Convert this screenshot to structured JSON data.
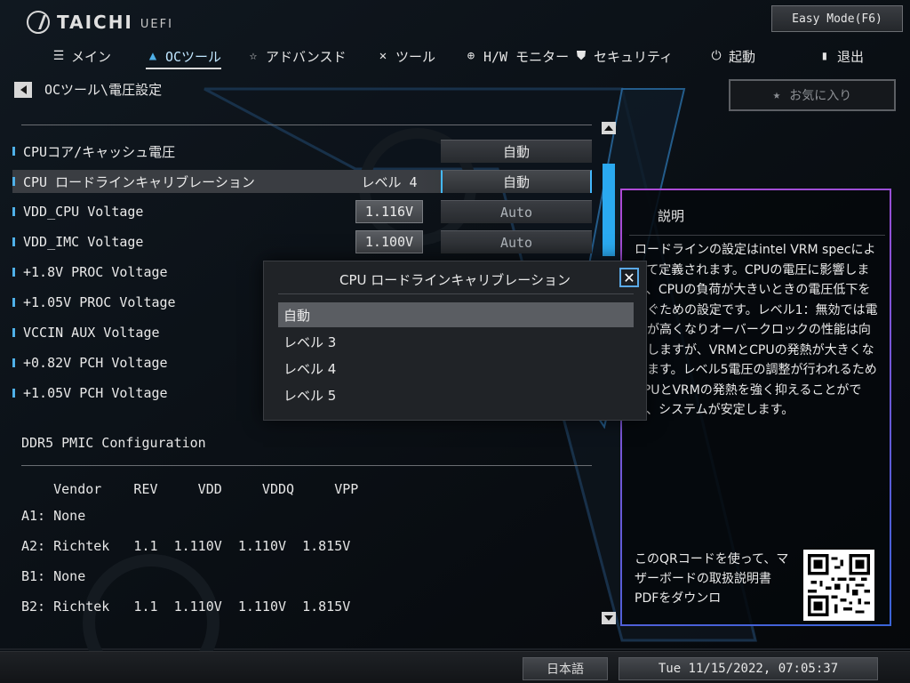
{
  "brand": {
    "name": "TAICHI",
    "sub": "UEFI"
  },
  "easy_mode": "Easy Mode(F6)",
  "nav": [
    {
      "label": "メイン",
      "icon": "list-icon"
    },
    {
      "label": "OCツール",
      "icon": "rocket-icon"
    },
    {
      "label": "アドバンスド",
      "icon": "star-icon"
    },
    {
      "label": "ツール",
      "icon": "tools-icon"
    },
    {
      "label": "H/W モニター",
      "icon": "monitor-icon"
    },
    {
      "label": "セキュリティ",
      "icon": "shield-icon"
    },
    {
      "label": "起動",
      "icon": "power-icon"
    },
    {
      "label": "退出",
      "icon": "exit-icon"
    }
  ],
  "breadcrumb": "OCツール\\電圧設定",
  "favorites": "お気に入り",
  "settings": [
    {
      "label": "CPUコア/キャッシュ電圧",
      "current": "",
      "value": "自動"
    },
    {
      "label": "CPU ロードラインキャリブレーション",
      "current": "レベル 4",
      "value": "自動"
    },
    {
      "label": "VDD_CPU Voltage",
      "current": "1.116V",
      "value": "Auto"
    },
    {
      "label": "VDD_IMC Voltage",
      "current": "1.100V",
      "value": "Auto"
    },
    {
      "label": "+1.8V PROC Voltage",
      "current": "",
      "value": ""
    },
    {
      "label": "+1.05V PROC Voltage",
      "current": "",
      "value": ""
    },
    {
      "label": "VCCIN AUX Voltage",
      "current": "",
      "value": ""
    },
    {
      "label": "+0.82V PCH Voltage",
      "current": "",
      "value": ""
    },
    {
      "label": "+1.05V PCH Voltage",
      "current": "",
      "value": ""
    }
  ],
  "pmic": {
    "title": "DDR5 PMIC Configuration",
    "header": "    Vendor    REV     VDD     VDDQ     VPP",
    "rows": [
      "A1: None",
      "A2: Richtek   1.1  1.110V  1.110V  1.815V",
      "B1: None",
      "B2: Richtek   1.1  1.110V  1.110V  1.815V"
    ]
  },
  "description": {
    "title": "説明",
    "text": "ロードラインの設定はintel VRM specによって定義されます。CPUの電圧に影響します、CPUの負荷が大きいときの電圧低下を防ぐための設定です。レベル1：無効では電圧が高くなりオーバークロックの性能は向上しますが、VRMとCPUの発熱が大きくなります。レベル5電圧の調整が行われるためCPUとVRMの発熱を強く抑えることができ、システムが安定します。",
    "qr_text": "このQRコードを使って、マザーボードの取扱説明書PDFをダウンロ"
  },
  "modal": {
    "title": "CPU ロードラインキャリブレーション",
    "options": [
      "自動",
      "レベル 3",
      "レベル 4",
      "レベル 5"
    ],
    "selected_index": 0
  },
  "status": {
    "language": "日本語",
    "datetime": "Tue 11/15/2022, 07:05:37"
  },
  "colors": {
    "accent": "#2aa9f0",
    "panel_border": "#b04ad6"
  }
}
